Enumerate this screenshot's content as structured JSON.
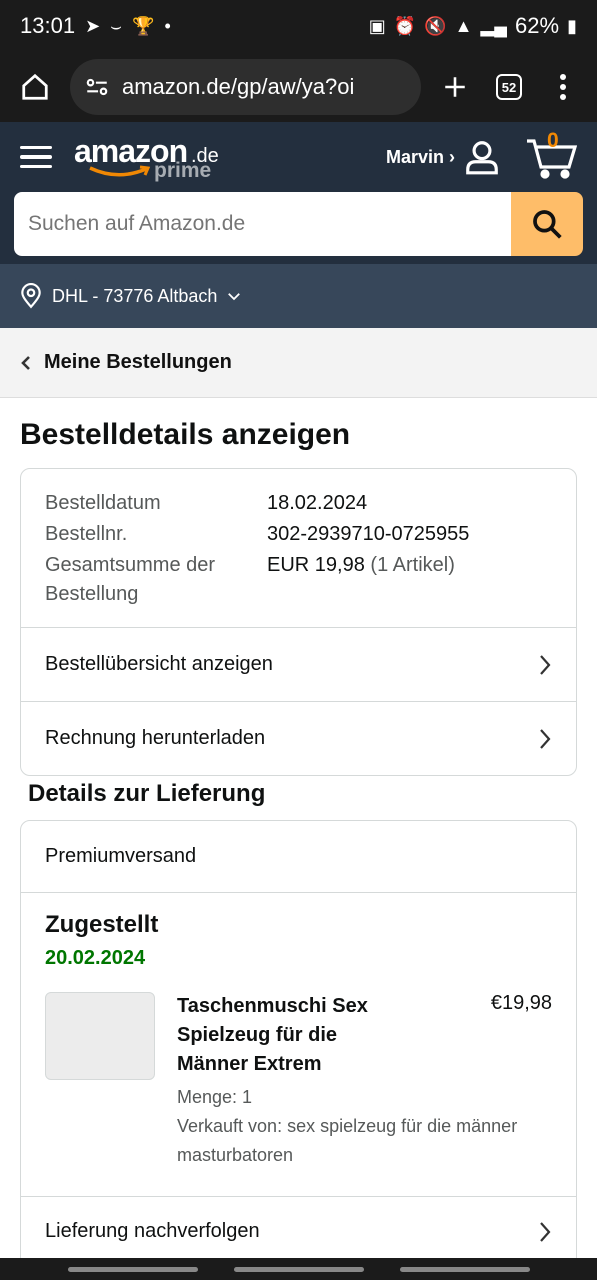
{
  "status_bar": {
    "time": "13:01",
    "battery": "62%"
  },
  "browser": {
    "url": "amazon.de/gp/aw/ya?oi",
    "tab_count": "52"
  },
  "header": {
    "logo_word": "amazon",
    "logo_tld": ".de",
    "logo_prime": "prime",
    "account_label": "Marvin ›",
    "cart_count": "0",
    "search_placeholder": "Suchen auf Amazon.de",
    "deliver_to": "DHL - 73776 Altbach"
  },
  "back_link": "Meine Bestellungen",
  "page_title": "Bestelldetails anzeigen",
  "order_info": {
    "date_label": "Bestelldatum",
    "date_value": "18.02.2024",
    "number_label": "Bestellnr.",
    "number_value": "302-2939710-0725955",
    "total_label": "Gesamtsumme der Bestellung",
    "total_value": "EUR 19,98",
    "total_items": "(1 Artikel)"
  },
  "order_links": [
    {
      "label": "Bestellübersicht anzeigen"
    },
    {
      "label": "Rechnung herunterladen"
    }
  ],
  "delivery": {
    "section_title": "Details zur Lieferung",
    "ship_method": "Premiumversand",
    "status": "Zugestellt",
    "status_date": "20.02.2024",
    "item": {
      "name": "Taschenmuschi Sex Spielzeug für die Männer Extrem",
      "price": "€19,98",
      "quantity": "Menge: 1",
      "seller": "Verkauft von: sex spielzeug für die männer masturbatoren",
      "image_alt": "product image (placeholder)"
    },
    "track_label": "Lieferung nachverfolgen"
  },
  "colors": {
    "header_bg": "#232f3e",
    "subheader_bg": "#37475a",
    "search_button": "#febd69",
    "delivered_green": "#007600",
    "cart_orange": "#f08804"
  }
}
